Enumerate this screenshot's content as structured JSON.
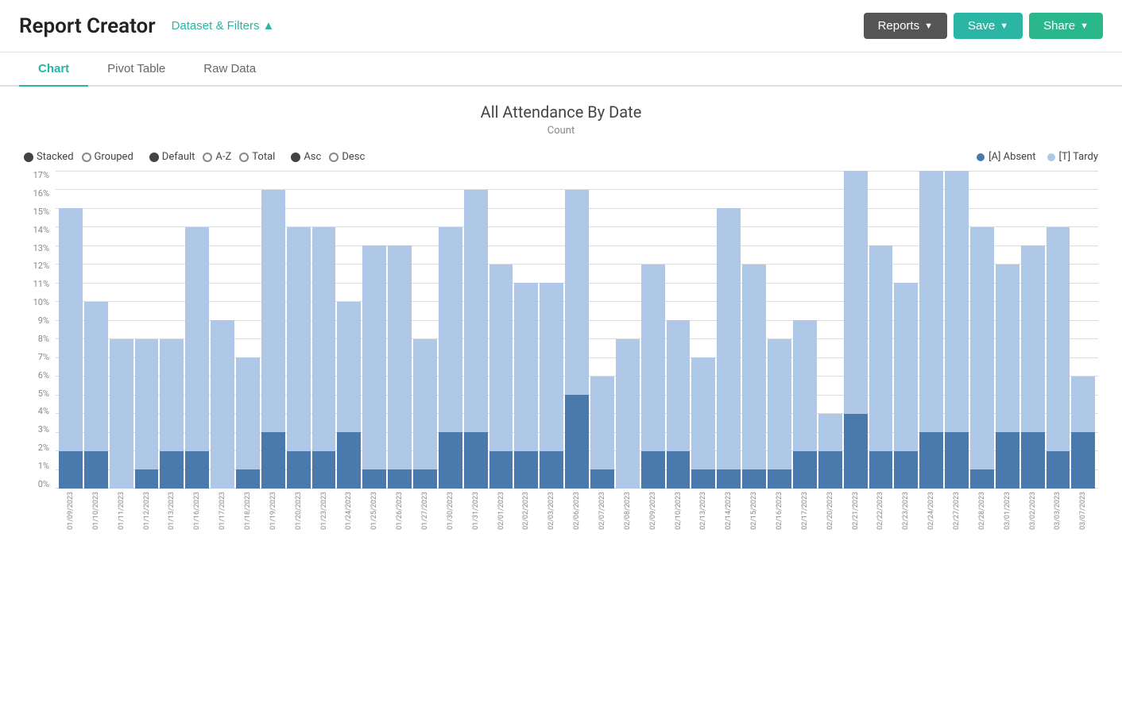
{
  "header": {
    "title": "Report Creator",
    "dataset_filters_label": "Dataset & Filters",
    "dataset_filters_arrow": "▲"
  },
  "buttons": {
    "reports": "Reports",
    "save": "Save",
    "share": "Share",
    "reports_arrow": "▼",
    "save_arrow": "▼",
    "share_arrow": "▼"
  },
  "tabs": [
    {
      "label": "Chart",
      "active": true
    },
    {
      "label": "Pivot Table",
      "active": false
    },
    {
      "label": "Raw Data",
      "active": false
    }
  ],
  "chart": {
    "title": "All Attendance By Date",
    "subtitle": "Count",
    "controls": {
      "layout": [
        {
          "label": "Stacked",
          "selected": true
        },
        {
          "label": "Grouped",
          "selected": false
        }
      ],
      "sort_by": [
        {
          "label": "Default",
          "selected": true
        },
        {
          "label": "A-Z",
          "selected": false
        },
        {
          "label": "Total",
          "selected": false
        }
      ],
      "order": [
        {
          "label": "Asc",
          "selected": true
        },
        {
          "label": "Desc",
          "selected": false
        }
      ]
    },
    "legend": [
      {
        "label": "[A] Absent",
        "color": "absent"
      },
      {
        "label": "[T] Tardy",
        "color": "tardy"
      }
    ],
    "y_axis": [
      "0%",
      "1%",
      "2%",
      "3%",
      "4%",
      "5%",
      "6%",
      "7%",
      "8%",
      "9%",
      "10%",
      "11%",
      "12%",
      "13%",
      "14%",
      "15%",
      "16%",
      "17%"
    ],
    "bars": [
      {
        "date": "01/09/2023",
        "absent": 2,
        "tardy": 13
      },
      {
        "date": "01/10/2023",
        "absent": 2,
        "tardy": 8
      },
      {
        "date": "01/11/2023",
        "absent": 0,
        "tardy": 8
      },
      {
        "date": "01/12/2023",
        "absent": 1,
        "tardy": 7
      },
      {
        "date": "01/13/2023",
        "absent": 2,
        "tardy": 6
      },
      {
        "date": "01/16/2023",
        "absent": 2,
        "tardy": 12
      },
      {
        "date": "01/17/2023",
        "absent": 0,
        "tardy": 9
      },
      {
        "date": "01/18/2023",
        "absent": 1,
        "tardy": 6
      },
      {
        "date": "01/19/2023",
        "absent": 3,
        "tardy": 13
      },
      {
        "date": "01/20/2023",
        "absent": 2,
        "tardy": 12
      },
      {
        "date": "01/23/2023",
        "absent": 2,
        "tardy": 12
      },
      {
        "date": "01/24/2023",
        "absent": 3,
        "tardy": 7
      },
      {
        "date": "01/25/2023",
        "absent": 1,
        "tardy": 12
      },
      {
        "date": "01/26/2023",
        "absent": 1,
        "tardy": 12
      },
      {
        "date": "01/27/2023",
        "absent": 1,
        "tardy": 7
      },
      {
        "date": "01/30/2023",
        "absent": 3,
        "tardy": 11
      },
      {
        "date": "01/31/2023",
        "absent": 3,
        "tardy": 13
      },
      {
        "date": "02/01/2023",
        "absent": 2,
        "tardy": 10
      },
      {
        "date": "02/02/2023",
        "absent": 2,
        "tardy": 9
      },
      {
        "date": "02/03/2023",
        "absent": 2,
        "tardy": 9
      },
      {
        "date": "02/06/2023",
        "absent": 5,
        "tardy": 11
      },
      {
        "date": "02/07/2023",
        "absent": 1,
        "tardy": 5
      },
      {
        "date": "02/08/2023",
        "absent": 0,
        "tardy": 8
      },
      {
        "date": "02/09/2023",
        "absent": 2,
        "tardy": 10
      },
      {
        "date": "02/10/2023",
        "absent": 2,
        "tardy": 7
      },
      {
        "date": "02/13/2023",
        "absent": 1,
        "tardy": 6
      },
      {
        "date": "02/14/2023",
        "absent": 1,
        "tardy": 14
      },
      {
        "date": "02/15/2023",
        "absent": 1,
        "tardy": 11
      },
      {
        "date": "02/16/2023",
        "absent": 1,
        "tardy": 7
      },
      {
        "date": "02/17/2023",
        "absent": 2,
        "tardy": 7
      },
      {
        "date": "02/20/2023",
        "absent": 2,
        "tardy": 2
      },
      {
        "date": "02/21/2023",
        "absent": 4,
        "tardy": 15
      },
      {
        "date": "02/22/2023",
        "absent": 2,
        "tardy": 11
      },
      {
        "date": "02/23/2023",
        "absent": 2,
        "tardy": 9
      },
      {
        "date": "02/24/2023",
        "absent": 3,
        "tardy": 16
      },
      {
        "date": "02/27/2023",
        "absent": 3,
        "tardy": 14
      },
      {
        "date": "02/28/2023",
        "absent": 1,
        "tardy": 13
      },
      {
        "date": "03/01/2023",
        "absent": 3,
        "tardy": 9
      },
      {
        "date": "03/02/2023",
        "absent": 3,
        "tardy": 10
      },
      {
        "date": "03/03/2023",
        "absent": 2,
        "tardy": 12
      },
      {
        "date": "03/07/2023",
        "absent": 3,
        "tardy": 3
      }
    ]
  }
}
